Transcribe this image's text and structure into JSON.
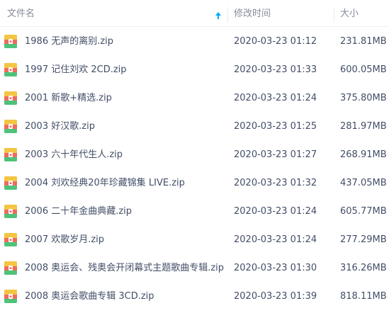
{
  "header": {
    "name_label": "文件名",
    "time_label": "修改时间",
    "size_label": "大小",
    "sort_icon": "sort-ascending-arrow-icon"
  },
  "colors": {
    "header_text": "#878c9c",
    "row_text": "#424e67",
    "accent": "#06a7ff"
  },
  "files": [
    {
      "name": "1986 无声的离别.zip",
      "modified": "2020-03-23 01:12",
      "size": "231.81MB",
      "icon": "zip-archive-icon"
    },
    {
      "name": "1997 记住刘欢 2CD.zip",
      "modified": "2020-03-23 01:33",
      "size": "600.05MB",
      "icon": "zip-archive-icon"
    },
    {
      "name": "2001 新歌+精选.zip",
      "modified": "2020-03-23 01:24",
      "size": "375.80MB",
      "icon": "zip-archive-icon"
    },
    {
      "name": "2003 好汉歌.zip",
      "modified": "2020-03-23 01:25",
      "size": "281.97MB",
      "icon": "zip-archive-icon"
    },
    {
      "name": "2003 六十年代生人.zip",
      "modified": "2020-03-23 01:27",
      "size": "268.91MB",
      "icon": "zip-archive-icon"
    },
    {
      "name": "2004 刘欢经典20年珍藏锦集 LIVE.zip",
      "modified": "2020-03-23 01:32",
      "size": "437.05MB",
      "icon": "zip-archive-icon"
    },
    {
      "name": "2006 二十年金曲典藏.zip",
      "modified": "2020-03-23 01:24",
      "size": "605.77MB",
      "icon": "zip-archive-icon"
    },
    {
      "name": "2007  欢歌岁月.zip",
      "modified": "2020-03-23 01:24",
      "size": "277.29MB",
      "icon": "zip-archive-icon"
    },
    {
      "name": "2008 奥运会、残奥会开闭幕式主题歌曲专辑.zip",
      "modified": "2020-03-23 01:30",
      "size": "316.26MB",
      "icon": "zip-archive-icon"
    },
    {
      "name": "2008 奥运会歌曲专辑 3CD.zip",
      "modified": "2020-03-23 01:39",
      "size": "818.11MB",
      "icon": "zip-archive-icon"
    }
  ]
}
